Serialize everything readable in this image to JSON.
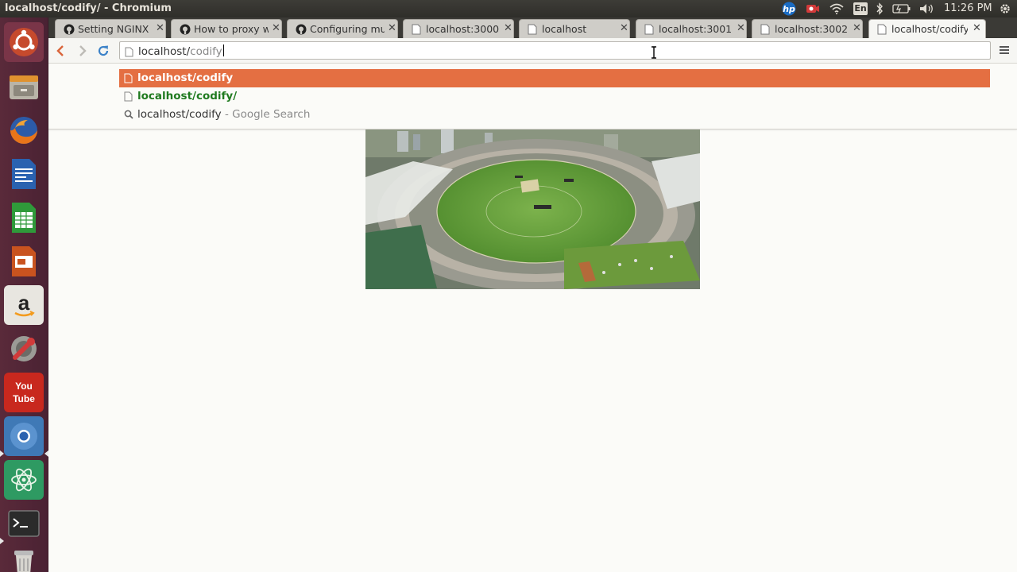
{
  "window": {
    "title": "localhost/codify/ - Chromium"
  },
  "system_tray": {
    "icons": [
      "hp-icon",
      "record-icon",
      "wifi-icon",
      "keyboard-language-icon",
      "bluetooth-icon",
      "battery-icon",
      "volume-icon",
      "settings-gear-icon"
    ],
    "keyboard_language": "En",
    "clock": "11:26 PM"
  },
  "launcher": {
    "items": [
      "ubuntu-dash-icon",
      "files-icon",
      "firefox-icon",
      "writer-icon",
      "calc-icon",
      "impress-icon",
      "amazon-icon",
      "system-settings-icon",
      "youtube-icon",
      "chromium-icon",
      "atom-icon",
      "terminal-icon",
      "trash-icon"
    ],
    "youtube_label_top": "You",
    "youtube_label_bottom": "Tube",
    "amazon_label": "a"
  },
  "tabs": [
    {
      "title": "Setting NGINX a",
      "icon": "github-icon",
      "active": false
    },
    {
      "title": "How to proxy w",
      "icon": "github-icon",
      "active": false
    },
    {
      "title": "Configuring mul",
      "icon": "github-icon",
      "active": false
    },
    {
      "title": "localhost:3000",
      "icon": "page-icon",
      "active": false
    },
    {
      "title": "localhost",
      "icon": "page-icon",
      "active": false
    },
    {
      "title": "localhost:3001",
      "icon": "page-icon",
      "active": false
    },
    {
      "title": "localhost:3002",
      "icon": "page-icon",
      "active": false
    },
    {
      "title": "localhost/codify",
      "icon": "page-icon",
      "active": true
    }
  ],
  "toolbar": {
    "address_typed": "localhost/",
    "address_autocomplete": "codify",
    "address_value": "localhost/codify"
  },
  "suggestions": [
    {
      "text": "localhost/codify",
      "suffix": "",
      "icon": "page-icon",
      "selected": true
    },
    {
      "text": "localhost/codify/",
      "suffix": "",
      "icon": "page-icon",
      "selected": false
    },
    {
      "text": "localhost/codify",
      "suffix": " - Google Search",
      "icon": "search-icon",
      "selected": false
    }
  ],
  "content": {
    "image": "cricket-stadium-aerial-photo"
  },
  "colors": {
    "accent": "#e46f42",
    "launcher": "#4a2233",
    "panel": "#3d3c37"
  }
}
